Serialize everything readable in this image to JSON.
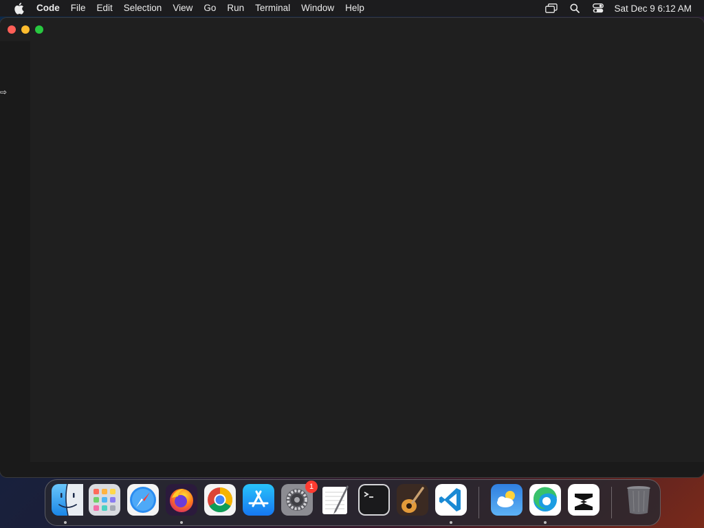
{
  "menubar": {
    "apple_icon": "apple-logo-icon",
    "items": [
      {
        "label": "Code",
        "bold": true
      },
      {
        "label": "File"
      },
      {
        "label": "Edit"
      },
      {
        "label": "Selection"
      },
      {
        "label": "View"
      },
      {
        "label": "Go"
      },
      {
        "label": "Run"
      },
      {
        "label": "Terminal"
      },
      {
        "label": "Window"
      },
      {
        "label": "Help"
      }
    ],
    "status_icons": [
      "screen-mirroring-icon",
      "spotlight-search-icon",
      "control-center-icon"
    ],
    "clock": "Sat Dec 9  6:12 AM"
  },
  "window": {
    "app": "Visual Studio Code",
    "traffic_lights": {
      "close": "#ff5f57",
      "minimize": "#febc2e",
      "maximize": "#28c840"
    },
    "editor_background": "#1f1f1f",
    "cursor_glyph": "⇨"
  },
  "dock": {
    "items": [
      {
        "name": "Finder",
        "icon": "finder-icon",
        "running": true
      },
      {
        "name": "Launchpad",
        "icon": "launchpad-icon",
        "running": false
      },
      {
        "name": "Safari",
        "icon": "safari-icon",
        "running": false
      },
      {
        "name": "Firefox",
        "icon": "firefox-icon",
        "running": true
      },
      {
        "name": "Google Chrome",
        "icon": "chrome-icon",
        "running": false
      },
      {
        "name": "App Store",
        "icon": "app-store-icon",
        "running": false
      },
      {
        "name": "System Settings",
        "icon": "system-settings-icon",
        "running": false,
        "badge": "1"
      },
      {
        "name": "TextEdit",
        "icon": "textedit-icon",
        "running": false
      },
      {
        "name": "Terminal",
        "icon": "terminal-icon",
        "running": false
      },
      {
        "name": "GarageBand",
        "icon": "garageband-icon",
        "running": false
      },
      {
        "name": "Visual Studio Code",
        "icon": "vscode-icon",
        "running": true
      },
      {
        "name": "Weather",
        "icon": "weather-icon",
        "running": false
      },
      {
        "name": "Microsoft Edge",
        "icon": "edge-icon",
        "running": true
      },
      {
        "name": "CapCut",
        "icon": "capcut-icon",
        "running": false
      },
      {
        "name": "Trash",
        "icon": "trash-icon",
        "running": false
      }
    ]
  }
}
